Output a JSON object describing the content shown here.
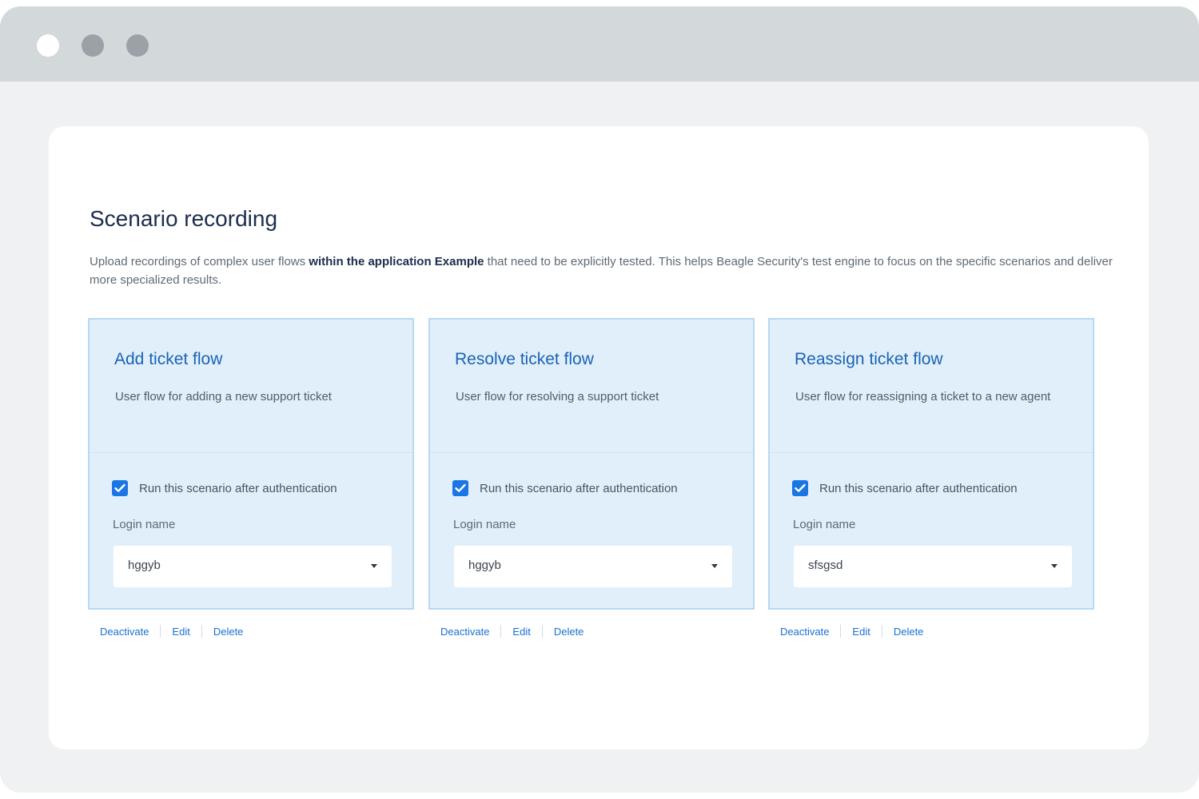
{
  "window": {
    "controls": [
      "close-dot",
      "minimize-dot",
      "maximize-dot"
    ]
  },
  "page": {
    "title": "Scenario recording",
    "description_before": "Upload recordings of complex user flows ",
    "description_bold": "within the application Example",
    "description_after": " that need to be explicitly tested. This helps Beagle Security's test engine to focus on the specific scenarios and deliver more specialized results."
  },
  "cards": [
    {
      "title": "Add ticket flow",
      "description": "User flow for adding a new support ticket",
      "checkbox_label": "Run this scenario after authentication",
      "checked": true,
      "login_label": "Login name",
      "login_value": "hggyb",
      "actions": {
        "deactivate": "Deactivate",
        "edit": "Edit",
        "delete": "Delete"
      }
    },
    {
      "title": "Resolve ticket flow",
      "description": "User flow for resolving a support ticket",
      "checkbox_label": "Run this scenario after authentication",
      "checked": true,
      "login_label": "Login name",
      "login_value": "hggyb",
      "actions": {
        "deactivate": "Deactivate",
        "edit": "Edit",
        "delete": "Delete"
      }
    },
    {
      "title": "Reassign ticket flow",
      "description": "User flow for reassigning a ticket to a new agent",
      "checkbox_label": "Run this scenario after authentication",
      "checked": true,
      "login_label": "Login name",
      "login_value": "sfsgsd",
      "actions": {
        "deactivate": "Deactivate",
        "edit": "Edit",
        "delete": "Delete"
      }
    }
  ],
  "colors": {
    "accent": "#1976e4",
    "title": "#1d2d4d",
    "card_bg": "#e1effb",
    "card_border": "#b8d8f4",
    "link": "#1a6fd4"
  },
  "icons": {
    "checkbox": "check-icon",
    "select": "caret-down-icon"
  }
}
